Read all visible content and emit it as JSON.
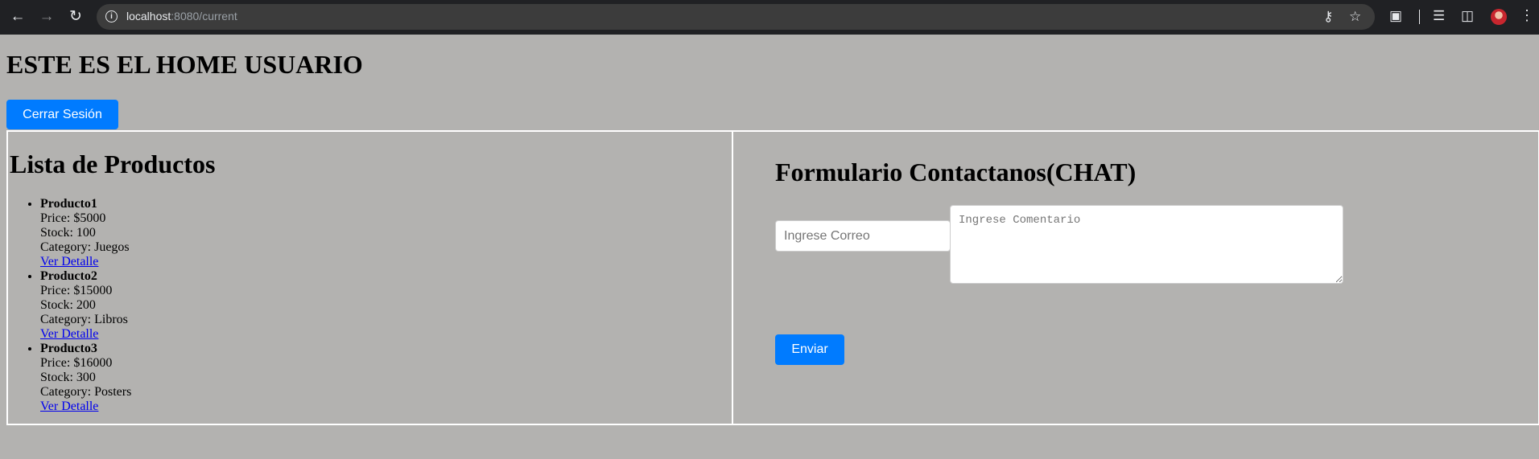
{
  "browser": {
    "url_host": "localhost",
    "url_rest": ":8080/current"
  },
  "page": {
    "title": "ESTE ES EL HOME USUARIO",
    "logout_label": "Cerrar Sesión"
  },
  "products": {
    "heading": "Lista de Productos",
    "items": [
      {
        "name": "Producto1",
        "price": "Price: $5000",
        "stock": "Stock: 100",
        "category": "Category: Juegos",
        "link": "Ver Detalle"
      },
      {
        "name": "Producto2",
        "price": "Price: $15000",
        "stock": "Stock: 200",
        "category": "Category: Libros",
        "link": "Ver Detalle"
      },
      {
        "name": "Producto3",
        "price": "Price: $16000",
        "stock": "Stock: 300",
        "category": "Category: Posters",
        "link": "Ver Detalle"
      }
    ]
  },
  "contact": {
    "heading": "Formulario Contactanos(CHAT)",
    "email_placeholder": "Ingrese Correo",
    "comment_placeholder": "Ingrese Comentario",
    "send_label": "Enviar"
  },
  "icons": {
    "back": "arrow-left",
    "forward": "arrow-right",
    "reload": "reload",
    "info": "info",
    "key": "key",
    "star": "star",
    "extensions": "puzzle",
    "media": "playlist",
    "side_panel": "side-panel",
    "profile": "avatar",
    "menu": "kebab"
  },
  "colors": {
    "page_background": "#b3b2b0",
    "button_primary": "#007bff",
    "link": "#0000ee"
  }
}
